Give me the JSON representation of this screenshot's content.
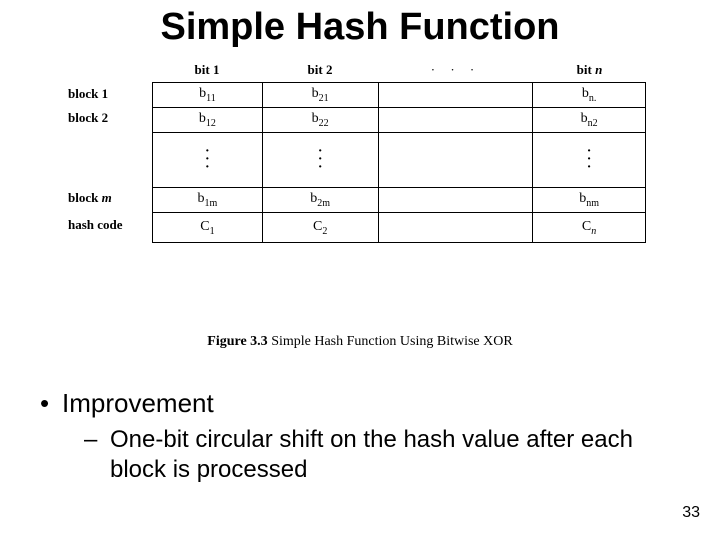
{
  "title": "Simple Hash Function",
  "columns": {
    "c1": "bit 1",
    "c2": "bit 2",
    "c3": "· · ·",
    "c4": "bit n"
  },
  "rows": {
    "r1": "block 1",
    "r2": "block 2",
    "rm": "block m",
    "rh": "hash code"
  },
  "cells": {
    "r1c1": "b",
    "r1c1s": "11",
    "r1c2": "b",
    "r1c2s": "21",
    "r1c4": "b",
    "r1c4s": "n.",
    "r2c1": "b",
    "r2c1s": "12",
    "r2c2": "b",
    "r2c2s": "22",
    "r2c4": "b",
    "r2c4s": "n2",
    "rmc1": "b",
    "rmc1s": "1m",
    "rmc2": "b",
    "rmc2s": "2m",
    "rmc4": "b",
    "rmc4s": "nm",
    "rhc1": "C",
    "rhc1s": "1",
    "rhc2": "C",
    "rhc2s": "2",
    "rhc4": "C",
    "rhc4s": "n"
  },
  "figure_label_prefix": "Figure 3.3 ",
  "figure_label": " Simple Hash Function Using Bitwise XOR",
  "bullet1": "Improvement",
  "bullet2": "One-bit circular shift on the hash value after each block is processed",
  "pageno": "33"
}
